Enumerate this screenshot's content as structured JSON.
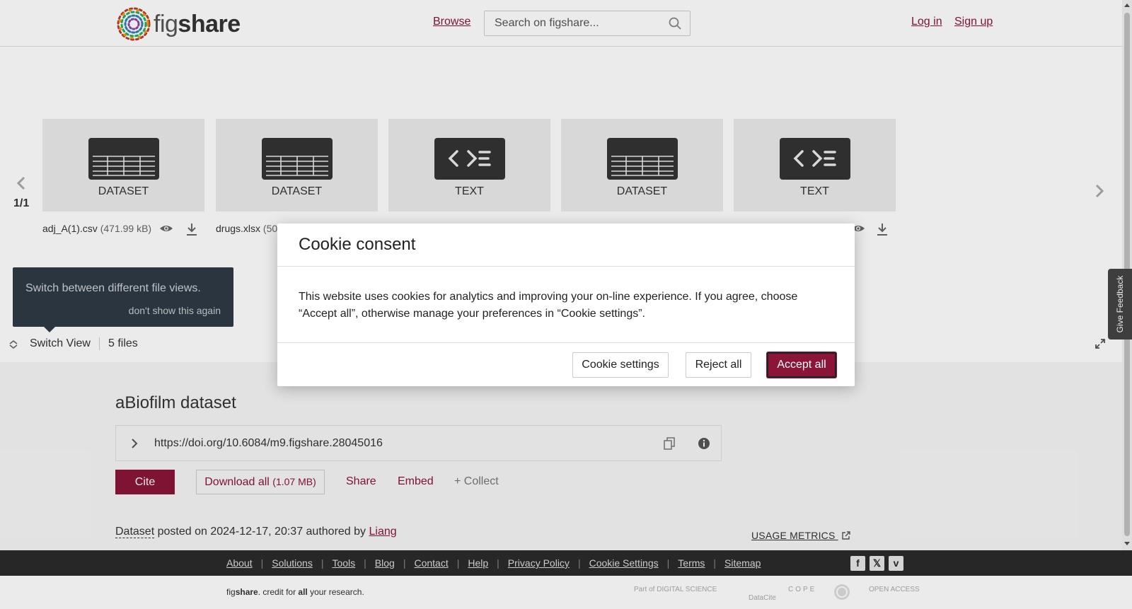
{
  "header": {
    "logo": "figshare",
    "browse_label": "Browse",
    "search_placeholder": "Search on figshare...",
    "login_label": "Log in",
    "signup_label": "Sign up"
  },
  "viewer": {
    "page_counter": "1/1",
    "tiles": [
      {
        "type_label": "DATASET",
        "icon": "table-icon"
      },
      {
        "type_label": "DATASET",
        "icon": "table-icon"
      },
      {
        "type_label": "TEXT",
        "icon": "code-icon"
      },
      {
        "type_label": "DATASET",
        "icon": "table-icon"
      },
      {
        "type_label": "TEXT",
        "icon": "code-icon"
      }
    ],
    "files": [
      {
        "name": "adj_A(1).csv",
        "size": "(471.99 kB)"
      },
      {
        "name": "drugs.xlsx",
        "size": "(50"
      }
    ],
    "tooltip_text": "Switch between different file views.",
    "tooltip_dismiss": "don't show this again",
    "switch_view_label": "Switch View",
    "file_count": "5 files"
  },
  "item": {
    "title": "aBiofilm dataset",
    "doi": "https://doi.org/10.6084/m9.figshare.28045016",
    "cite_label": "Cite",
    "download_label": "Download all",
    "download_size": "(1.07 MB)",
    "share_label": "Share",
    "embed_label": "Embed",
    "collect_label": "+ Collect",
    "item_type": "Dataset",
    "posted_text": " posted on 2024-12-17, 20:37 authored by ",
    "author": "Liang",
    "usage_metrics_label": "USAGE METRICS"
  },
  "feedback_label": "Give Feedback",
  "footer": {
    "links": [
      "About",
      "Solutions",
      "Tools",
      "Blog",
      "Contact",
      "Help",
      "Privacy Policy",
      "Cookie Settings",
      "Terms",
      "Sitemap"
    ],
    "tagline_fig": "fig",
    "tagline_share": "share",
    "tagline_mid": ". credit for ",
    "tagline_all": "all",
    "tagline_end": " your research.",
    "partners": [
      "Part of DIGITAL SCIENCE",
      "DataCite",
      "COPE",
      "",
      "OPEN ACCESS"
    ]
  },
  "cookie_modal": {
    "title": "Cookie consent",
    "body": "This website uses cookies for analytics and improving your on-line experience. If you agree, choose “Accept all”, otherwise manage your preferences in “Cookie settings”.",
    "settings_label": "Cookie settings",
    "reject_label": "Reject all",
    "accept_label": "Accept all"
  },
  "colors": {
    "brand": "#8a1538",
    "footer_bg": "#2b2b2b",
    "tile_bg": "#ebebeb",
    "tooltip_bg": "#2f3a45"
  }
}
